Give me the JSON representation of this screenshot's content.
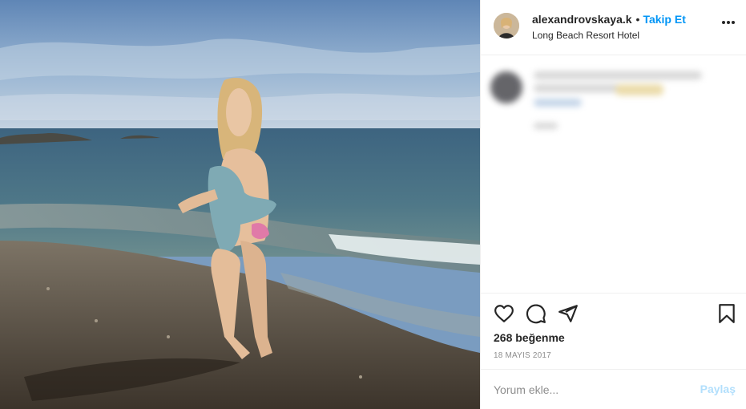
{
  "post": {
    "username": "alexandrovskaya.k",
    "separator": "•",
    "follow_label": "Takip Et",
    "location": "Long Beach Resort Hotel",
    "likes_text": "268 beğenme",
    "date": "18 MAYIS 2017"
  },
  "comment_box": {
    "placeholder": "Yorum ekle...",
    "share_label": "Paylaş"
  },
  "icons": {
    "more": "more-options-icon",
    "like": "heart-icon",
    "comment": "comment-icon",
    "share": "paper-plane-icon",
    "save": "bookmark-icon"
  },
  "colors": {
    "accent": "#0095f6",
    "share_disabled": "#b2dffc",
    "secondary_text": "#8e8e8e",
    "divider": "#efefef"
  }
}
